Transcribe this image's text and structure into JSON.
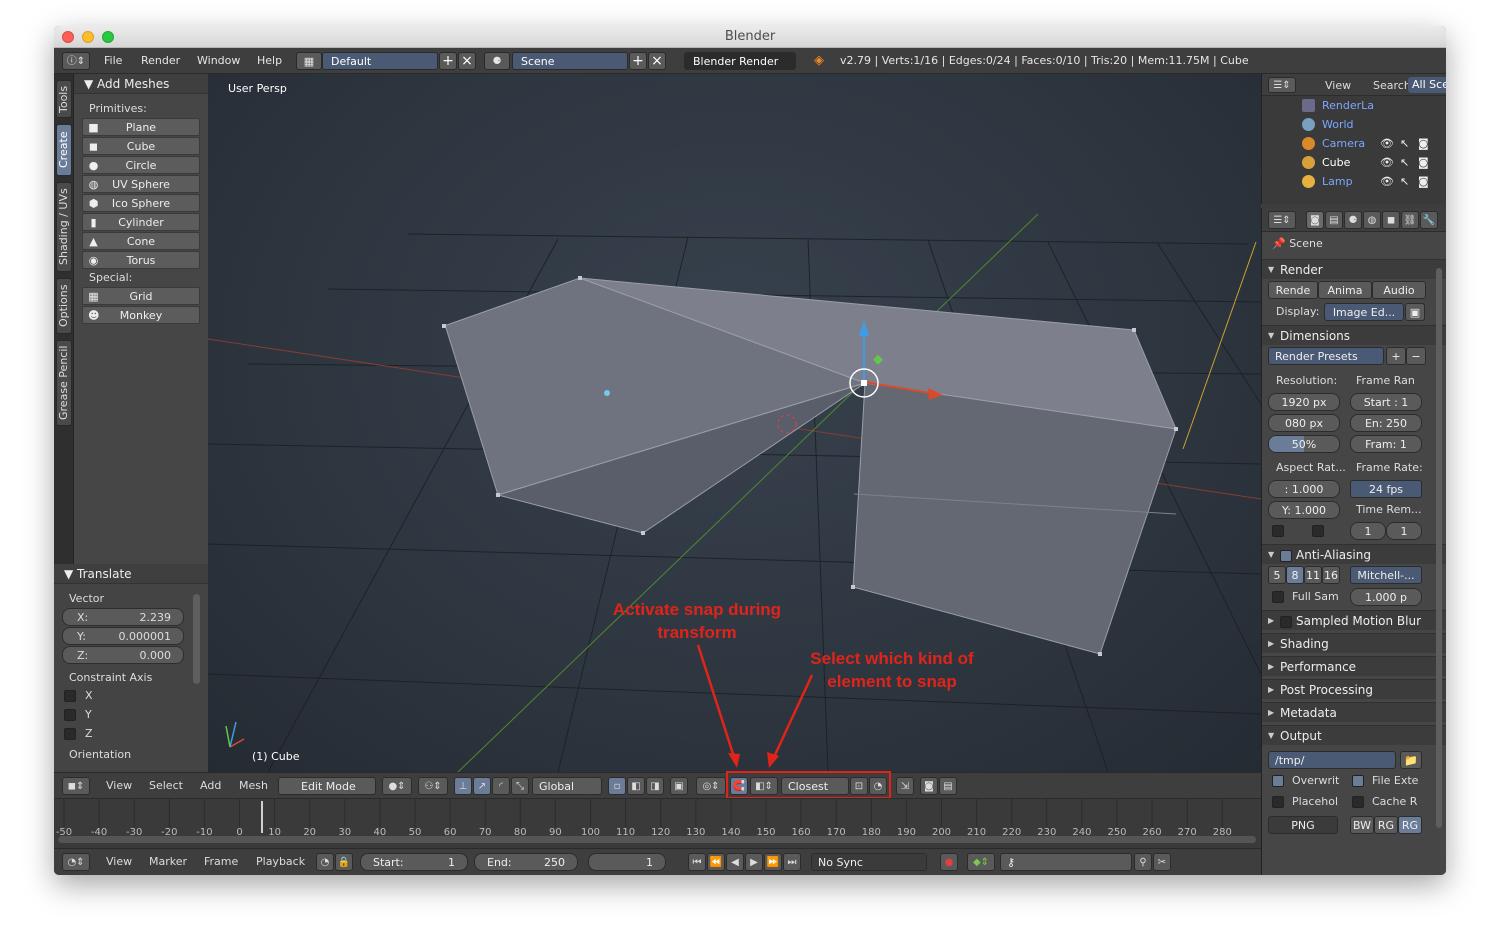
{
  "window": {
    "title": "Blender"
  },
  "infobar": {
    "menus": [
      "File",
      "Render",
      "Window",
      "Help"
    ],
    "layout": "Default",
    "scene": "Scene",
    "engine": "Blender Render",
    "stats": "v2.79 | Verts:1/16 | Edges:0/24 | Faces:0/10 | Tris:20 | Mem:11.75M | Cube"
  },
  "lefttabs": [
    "Tools",
    "Create",
    "Shading / UVs",
    "Options",
    "Grease Pencil"
  ],
  "toolpanel": {
    "header": "Add Meshes",
    "primitives_label": "Primitives:",
    "primitives": [
      "Plane",
      "Cube",
      "Circle",
      "UV Sphere",
      "Ico Sphere",
      "Cylinder",
      "Cone",
      "Torus"
    ],
    "special_label": "Special:",
    "special": [
      "Grid",
      "Monkey"
    ]
  },
  "translate": {
    "header": "Translate",
    "vector_label": "Vector",
    "vector": [
      {
        "k": "X:",
        "v": "2.239"
      },
      {
        "k": "Y:",
        "v": "0.000001"
      },
      {
        "k": "Z:",
        "v": "0.000"
      }
    ],
    "constraint_label": "Constraint Axis",
    "axes": [
      "X",
      "Y",
      "Z"
    ],
    "orientation_label": "Orientation"
  },
  "viewport": {
    "label": "User Persp",
    "footer": "(1) Cube"
  },
  "outliner": {
    "view": "View",
    "search": "Search",
    "all": "All Sce",
    "items": [
      "RenderLa",
      "World",
      "Camera",
      "Cube",
      "Lamp"
    ]
  },
  "props": {
    "scene": "Scene",
    "render": "Render",
    "render_btns": [
      "Rende",
      "Anima",
      "Audio"
    ],
    "display_label": "Display:",
    "display_value": "Image Ed...",
    "dimensions": "Dimensions",
    "presets": "Render Presets",
    "resolution_label": "Resolution:",
    "frame_range_label": "Frame Ran",
    "res_x": "1920 px",
    "res_y": "080 px",
    "res_pct": "50%",
    "start": "Start : 1",
    "end": "En: 250",
    "frame": "Fram: 1",
    "aspect_label": "Aspect Rat...",
    "frame_rate_label": "Frame Rate:",
    "aspect_x": ": 1.000",
    "aspect_y": "Y: 1.000",
    "fps": "24 fps",
    "time_rem_label": "Time Rem...",
    "time_a": "1",
    "time_b": "1",
    "aa": "Anti-Aliasing",
    "aa_samples": [
      "5",
      "8",
      "11",
      "16"
    ],
    "aa_filter": "Mitchell-...",
    "full_sample": "Full Sam",
    "filter_size": "1.000 p",
    "motion_blur": "Sampled Motion Blur",
    "shading": "Shading",
    "performance": "Performance",
    "post": "Post Processing",
    "metadata": "Metadata",
    "output": "Output",
    "path": "/tmp/",
    "overwrite": "Overwrit",
    "file_ext": "File Exte",
    "placeholder": "Placehol",
    "cache": "Cache R",
    "format": "PNG",
    "color_modes": [
      "BW",
      "RG",
      "RG"
    ]
  },
  "bar3d": {
    "view": "View",
    "select": "Select",
    "add": "Add",
    "mesh": "Mesh",
    "mode": "Edit Mode",
    "orientation": "Global",
    "snap_target": "Closest"
  },
  "timeline": {
    "ticks": [
      "-50",
      "-40",
      "-30",
      "-20",
      "-10",
      "0",
      "10",
      "20",
      "30",
      "40",
      "50",
      "60",
      "70",
      "80",
      "90",
      "100",
      "110",
      "120",
      "130",
      "140",
      "150",
      "160",
      "170",
      "180",
      "190",
      "200",
      "210",
      "220",
      "230",
      "240",
      "250",
      "260",
      "270",
      "280"
    ]
  },
  "tlbar": {
    "view": "View",
    "marker": "Marker",
    "frame": "Frame",
    "playback": "Playback",
    "start_label": "Start:",
    "start": "1",
    "end_label": "End:",
    "end": "250",
    "current": "1",
    "sync": "No Sync"
  },
  "annotations": {
    "snap": "Activate snap during transform",
    "element": "Select which kind of element to snap"
  },
  "colors": {
    "accent": "#4a5a75",
    "annotation": "#e0241a"
  }
}
